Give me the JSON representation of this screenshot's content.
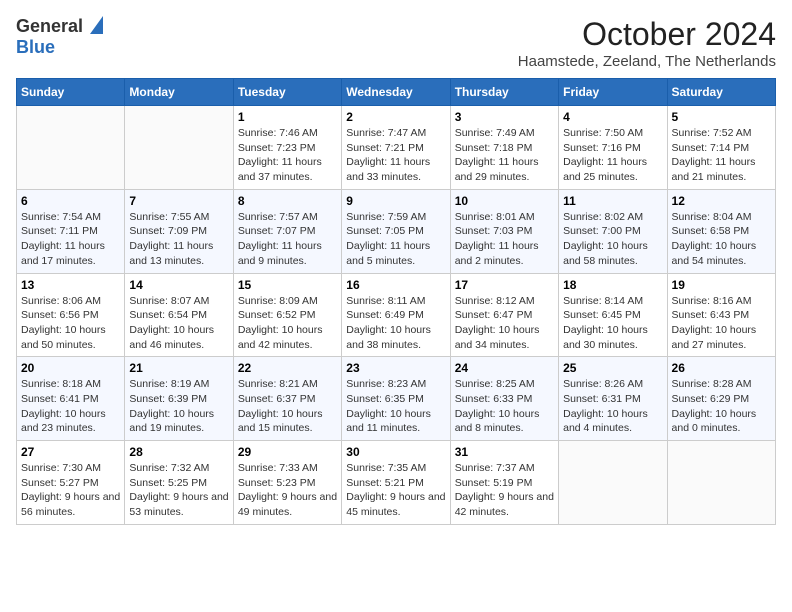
{
  "header": {
    "logo_general": "General",
    "logo_blue": "Blue",
    "month_title": "October 2024",
    "location": "Haamstede, Zeeland, The Netherlands"
  },
  "days_of_week": [
    "Sunday",
    "Monday",
    "Tuesday",
    "Wednesday",
    "Thursday",
    "Friday",
    "Saturday"
  ],
  "weeks": [
    [
      {
        "day": "",
        "content": ""
      },
      {
        "day": "",
        "content": ""
      },
      {
        "day": "1",
        "content": "Sunrise: 7:46 AM\nSunset: 7:23 PM\nDaylight: 11 hours and 37 minutes."
      },
      {
        "day": "2",
        "content": "Sunrise: 7:47 AM\nSunset: 7:21 PM\nDaylight: 11 hours and 33 minutes."
      },
      {
        "day": "3",
        "content": "Sunrise: 7:49 AM\nSunset: 7:18 PM\nDaylight: 11 hours and 29 minutes."
      },
      {
        "day": "4",
        "content": "Sunrise: 7:50 AM\nSunset: 7:16 PM\nDaylight: 11 hours and 25 minutes."
      },
      {
        "day": "5",
        "content": "Sunrise: 7:52 AM\nSunset: 7:14 PM\nDaylight: 11 hours and 21 minutes."
      }
    ],
    [
      {
        "day": "6",
        "content": "Sunrise: 7:54 AM\nSunset: 7:11 PM\nDaylight: 11 hours and 17 minutes."
      },
      {
        "day": "7",
        "content": "Sunrise: 7:55 AM\nSunset: 7:09 PM\nDaylight: 11 hours and 13 minutes."
      },
      {
        "day": "8",
        "content": "Sunrise: 7:57 AM\nSunset: 7:07 PM\nDaylight: 11 hours and 9 minutes."
      },
      {
        "day": "9",
        "content": "Sunrise: 7:59 AM\nSunset: 7:05 PM\nDaylight: 11 hours and 5 minutes."
      },
      {
        "day": "10",
        "content": "Sunrise: 8:01 AM\nSunset: 7:03 PM\nDaylight: 11 hours and 2 minutes."
      },
      {
        "day": "11",
        "content": "Sunrise: 8:02 AM\nSunset: 7:00 PM\nDaylight: 10 hours and 58 minutes."
      },
      {
        "day": "12",
        "content": "Sunrise: 8:04 AM\nSunset: 6:58 PM\nDaylight: 10 hours and 54 minutes."
      }
    ],
    [
      {
        "day": "13",
        "content": "Sunrise: 8:06 AM\nSunset: 6:56 PM\nDaylight: 10 hours and 50 minutes."
      },
      {
        "day": "14",
        "content": "Sunrise: 8:07 AM\nSunset: 6:54 PM\nDaylight: 10 hours and 46 minutes."
      },
      {
        "day": "15",
        "content": "Sunrise: 8:09 AM\nSunset: 6:52 PM\nDaylight: 10 hours and 42 minutes."
      },
      {
        "day": "16",
        "content": "Sunrise: 8:11 AM\nSunset: 6:49 PM\nDaylight: 10 hours and 38 minutes."
      },
      {
        "day": "17",
        "content": "Sunrise: 8:12 AM\nSunset: 6:47 PM\nDaylight: 10 hours and 34 minutes."
      },
      {
        "day": "18",
        "content": "Sunrise: 8:14 AM\nSunset: 6:45 PM\nDaylight: 10 hours and 30 minutes."
      },
      {
        "day": "19",
        "content": "Sunrise: 8:16 AM\nSunset: 6:43 PM\nDaylight: 10 hours and 27 minutes."
      }
    ],
    [
      {
        "day": "20",
        "content": "Sunrise: 8:18 AM\nSunset: 6:41 PM\nDaylight: 10 hours and 23 minutes."
      },
      {
        "day": "21",
        "content": "Sunrise: 8:19 AM\nSunset: 6:39 PM\nDaylight: 10 hours and 19 minutes."
      },
      {
        "day": "22",
        "content": "Sunrise: 8:21 AM\nSunset: 6:37 PM\nDaylight: 10 hours and 15 minutes."
      },
      {
        "day": "23",
        "content": "Sunrise: 8:23 AM\nSunset: 6:35 PM\nDaylight: 10 hours and 11 minutes."
      },
      {
        "day": "24",
        "content": "Sunrise: 8:25 AM\nSunset: 6:33 PM\nDaylight: 10 hours and 8 minutes."
      },
      {
        "day": "25",
        "content": "Sunrise: 8:26 AM\nSunset: 6:31 PM\nDaylight: 10 hours and 4 minutes."
      },
      {
        "day": "26",
        "content": "Sunrise: 8:28 AM\nSunset: 6:29 PM\nDaylight: 10 hours and 0 minutes."
      }
    ],
    [
      {
        "day": "27",
        "content": "Sunrise: 7:30 AM\nSunset: 5:27 PM\nDaylight: 9 hours and 56 minutes."
      },
      {
        "day": "28",
        "content": "Sunrise: 7:32 AM\nSunset: 5:25 PM\nDaylight: 9 hours and 53 minutes."
      },
      {
        "day": "29",
        "content": "Sunrise: 7:33 AM\nSunset: 5:23 PM\nDaylight: 9 hours and 49 minutes."
      },
      {
        "day": "30",
        "content": "Sunrise: 7:35 AM\nSunset: 5:21 PM\nDaylight: 9 hours and 45 minutes."
      },
      {
        "day": "31",
        "content": "Sunrise: 7:37 AM\nSunset: 5:19 PM\nDaylight: 9 hours and 42 minutes."
      },
      {
        "day": "",
        "content": ""
      },
      {
        "day": "",
        "content": ""
      }
    ]
  ]
}
